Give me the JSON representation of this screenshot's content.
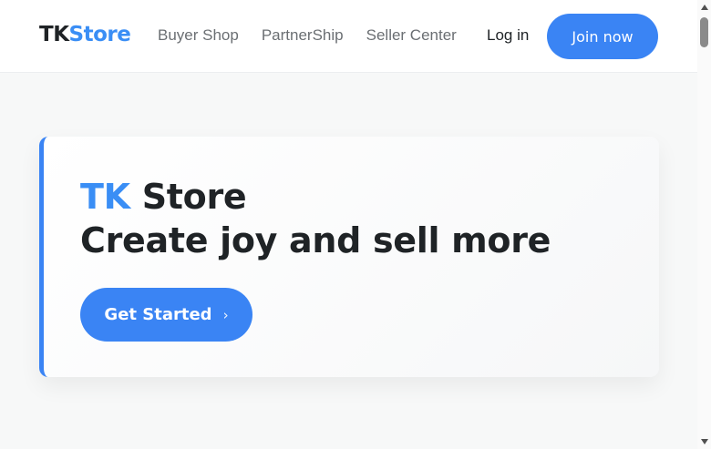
{
  "navbar": {
    "logo": {
      "part1": "TK",
      "part2": "Store"
    },
    "links": [
      "Buyer Shop",
      "PartnerShip",
      "Seller Center"
    ],
    "login_label": "Log in",
    "join_label": "Join now"
  },
  "hero": {
    "brand": "TK",
    "title_rest": " Store",
    "tagline": "Create joy and sell more",
    "cta_label": "Get Started",
    "cta_icon": "chevron-right-icon"
  },
  "colors": {
    "accent": "#3a84f4",
    "text_dark": "#1f2326",
    "nav_text": "#6b6f73",
    "background": "#f7f8f8"
  }
}
